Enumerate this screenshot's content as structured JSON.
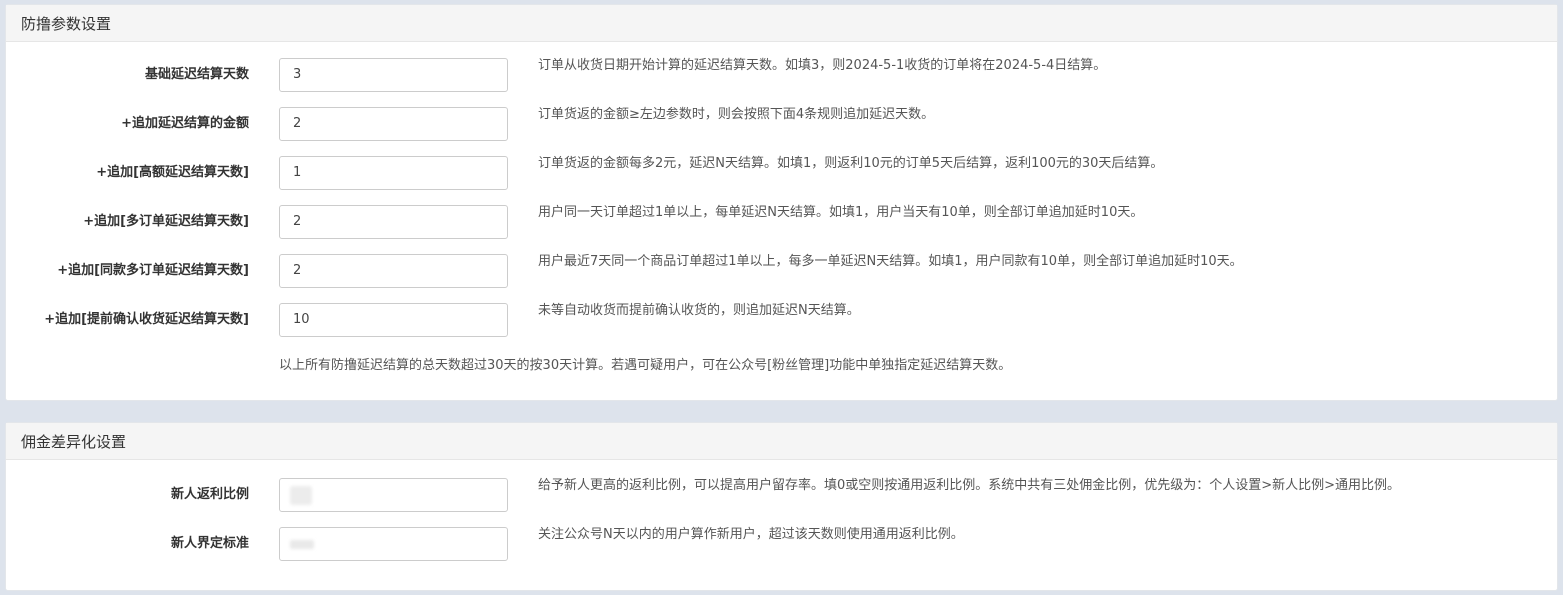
{
  "section1": {
    "title": "防撸参数设置",
    "rows": [
      {
        "label": "基础延迟结算天数",
        "value": "3",
        "help": "订单从收货日期开始计算的延迟结算天数。如填3，则2024-5-1收货的订单将在2024-5-4日结算。"
      },
      {
        "label": "+追加延迟结算的金额",
        "value": "2",
        "help": "订单货返的金额≥左边参数时，则会按照下面4条规则追加延迟天数。"
      },
      {
        "label": "+追加[高额延迟结算天数]",
        "value": "1",
        "help": "订单货返的金额每多2元，延迟N天结算。如填1，则返利10元的订单5天后结算，返利100元的30天后结算。"
      },
      {
        "label": "+追加[多订单延迟结算天数]",
        "value": "2",
        "help": "用户同一天订单超过1单以上，每单延迟N天结算。如填1，用户当天有10单，则全部订单追加延时10天。"
      },
      {
        "label": "+追加[同款多订单延迟结算天数]",
        "value": "2",
        "help": "用户最近7天同一个商品订单超过1单以上，每多一单延迟N天结算。如填1，用户同款有10单，则全部订单追加延时10天。"
      },
      {
        "label": "+追加[提前确认收货延迟结算天数]",
        "value": "10",
        "help": "未等自动收货而提前确认收货的，则追加延迟N天结算。"
      }
    ],
    "note": "以上所有防撸延迟结算的总天数超过30天的按30天计算。若遇可疑用户，可在公众号[粉丝管理]功能中单独指定延迟结算天数。"
  },
  "section2": {
    "title": "佣金差异化设置",
    "rows": [
      {
        "label": "新人返利比例",
        "value": "",
        "help": "给予新人更高的返利比例，可以提高用户留存率。填0或空则按通用返利比例。系统中共有三处佣金比例，优先级为：个人设置>新人比例>通用比例。"
      },
      {
        "label": "新人界定标准",
        "value": "",
        "help": "关注公众号N天以内的用户算作新用户，超过该天数则使用通用返利比例。"
      }
    ]
  }
}
